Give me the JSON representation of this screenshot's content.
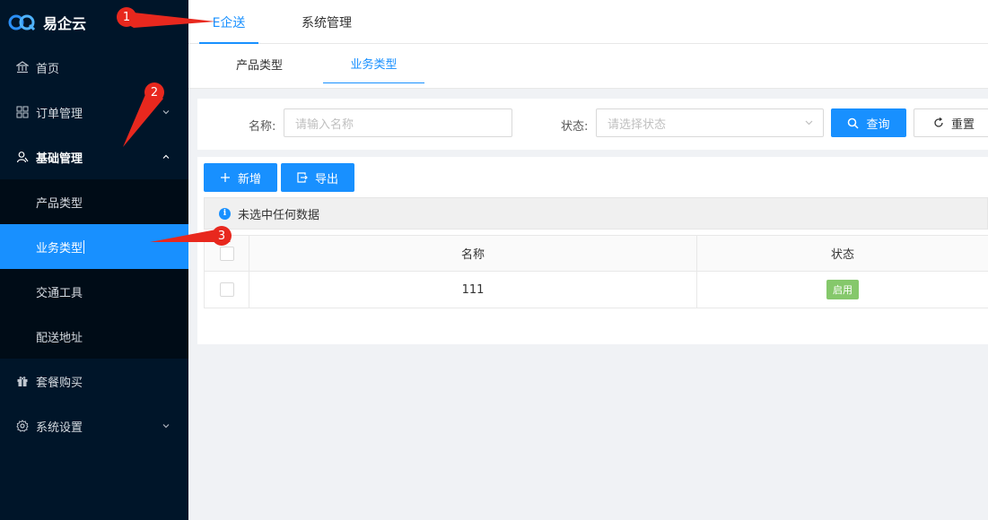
{
  "app": {
    "name": "易企云"
  },
  "sidebar": {
    "items": [
      {
        "label": "首页",
        "icon": "bank-icon"
      },
      {
        "label": "订单管理",
        "icon": "grid-icon"
      },
      {
        "label": "基础管理",
        "icon": "user-group-icon"
      },
      {
        "label": "套餐购买",
        "icon": "gift-icon"
      },
      {
        "label": "系统设置",
        "icon": "gear-icon"
      }
    ],
    "submenu": [
      "产品类型",
      "业务类型",
      "交通工具",
      "配送地址"
    ]
  },
  "topnav": {
    "tabs": [
      "E企送",
      "系统管理"
    ]
  },
  "subnav": {
    "tabs": [
      "产品类型",
      "业务类型"
    ]
  },
  "search": {
    "name_label": "名称:",
    "name_placeholder": "请输入名称",
    "status_label": "状态:",
    "status_placeholder": "请选择状态",
    "query_label": "查询",
    "reset_label": "重置"
  },
  "toolbar": {
    "add_label": "新增",
    "export_label": "导出"
  },
  "alert": {
    "text": "未选中任何数据"
  },
  "table": {
    "columns": [
      "名称",
      "状态"
    ],
    "rows": [
      {
        "name": "111",
        "status": "启用"
      }
    ]
  },
  "annotations": [
    "1",
    "2",
    "3"
  ],
  "colors": {
    "accent": "#1890ff",
    "sidebar": "#001529",
    "tag": "#85c86b",
    "marker": "#e8281e"
  }
}
